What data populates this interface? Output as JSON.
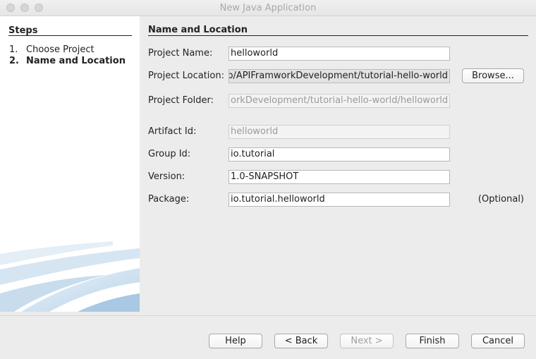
{
  "window": {
    "title": "New Java Application"
  },
  "steps": {
    "title": "Steps",
    "items": [
      {
        "num": "1.",
        "label": "Choose Project"
      },
      {
        "num": "2.",
        "label": "Name and Location"
      }
    ]
  },
  "section": {
    "title": "Name and Location"
  },
  "form": {
    "project_name": {
      "label": "Project Name:",
      "value": "helloworld"
    },
    "project_location": {
      "label": "Project Location:",
      "value": "p/APIFramworkDevelopment/tutorial-hello-world"
    },
    "project_folder": {
      "label": "Project Folder:",
      "value": "orkDevelopment/tutorial-hello-world/helloworld"
    },
    "artifact_id": {
      "label": "Artifact Id:",
      "value": "helloworld"
    },
    "group_id": {
      "label": "Group Id:",
      "value": "io.tutorial"
    },
    "version": {
      "label": "Version:",
      "value": "1.0-SNAPSHOT"
    },
    "package": {
      "label": "Package:",
      "value": "io.tutorial.helloworld",
      "hint": "(Optional)"
    },
    "browse_label": "Browse..."
  },
  "buttons": {
    "help": "Help",
    "back": "< Back",
    "next": "Next >",
    "finish": "Finish",
    "cancel": "Cancel"
  }
}
